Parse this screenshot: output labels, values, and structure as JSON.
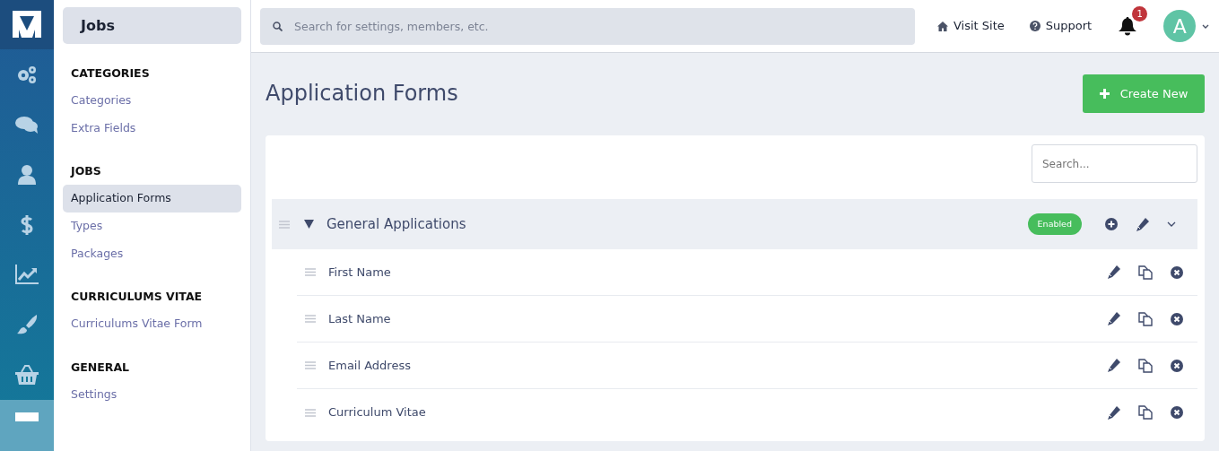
{
  "rail": [
    {
      "selected": false
    },
    {
      "selected": false
    },
    {
      "selected": false
    },
    {
      "selected": false
    },
    {
      "selected": false
    },
    {
      "selected": false
    },
    {
      "selected": false
    },
    {
      "selected": true
    }
  ],
  "sidebar": {
    "title": "Jobs",
    "sections": [
      {
        "heading": "CATEGORIES",
        "items": [
          {
            "label": "Categories",
            "selected": false
          },
          {
            "label": "Extra Fields",
            "selected": false
          }
        ]
      },
      {
        "heading": "JOBS",
        "items": [
          {
            "label": "Application Forms",
            "selected": true
          },
          {
            "label": "Types",
            "selected": false
          },
          {
            "label": "Packages",
            "selected": false
          }
        ]
      },
      {
        "heading": "CURRICULUMS VITAE",
        "items": [
          {
            "label": "Curriculums Vitae Form",
            "selected": false
          }
        ]
      },
      {
        "heading": "GENERAL",
        "items": [
          {
            "label": "Settings",
            "selected": false
          }
        ]
      }
    ]
  },
  "topbar": {
    "search": {
      "placeholder": "Search for settings, members, etc."
    },
    "links": [
      {
        "label": "Visit Site"
      },
      {
        "label": "Support"
      }
    ],
    "notifications": "1",
    "avatar": "A"
  },
  "page": {
    "title": "Application Forms",
    "create_button": "Create New",
    "search": {
      "placeholder": "Search..."
    },
    "groups": [
      {
        "name": "General Applications",
        "expanded": true,
        "status": "Enabled",
        "fields": [
          {
            "label": "First Name"
          },
          {
            "label": "Last Name"
          },
          {
            "label": "Email Address"
          },
          {
            "label": "Curriculum Vitae"
          }
        ]
      }
    ]
  }
}
